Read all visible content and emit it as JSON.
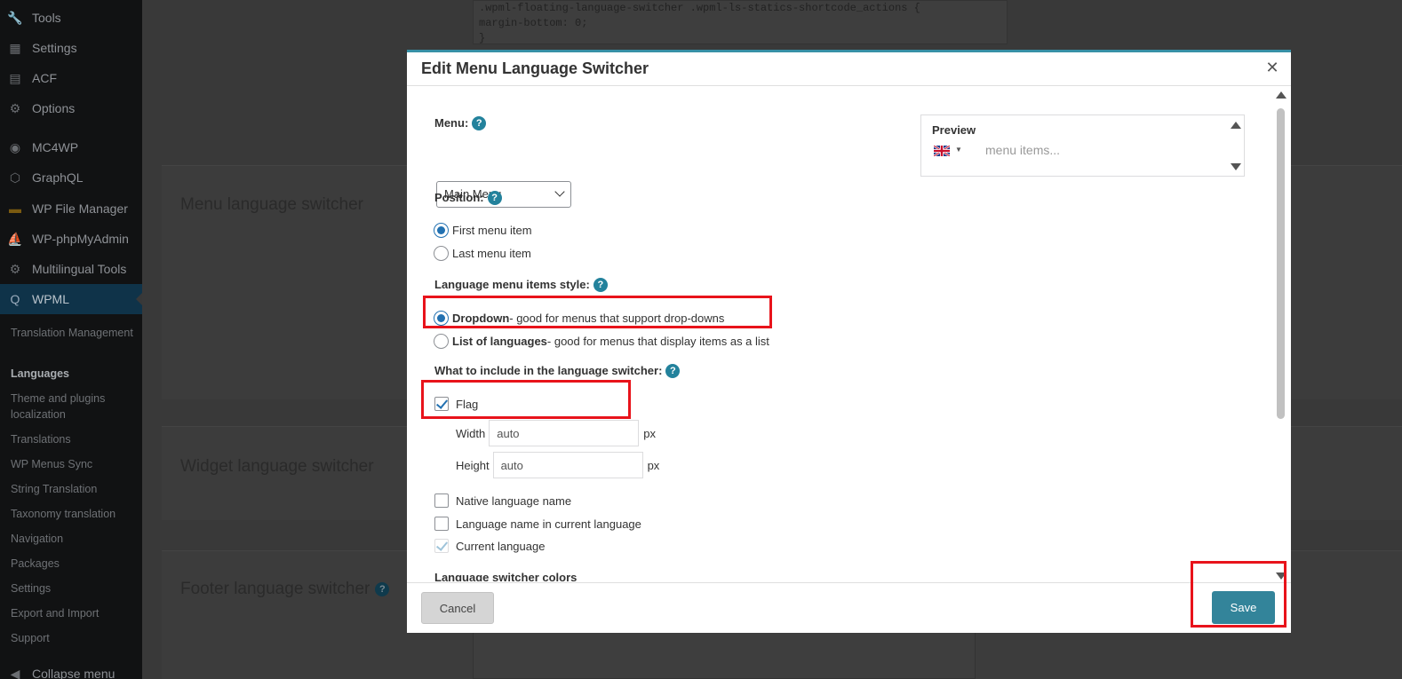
{
  "sidebar": {
    "items": [
      {
        "label": "Tools",
        "icon": "wrench-icon"
      },
      {
        "label": "Settings",
        "icon": "settings-sliders-icon"
      },
      {
        "label": "ACF",
        "icon": "grid-icon"
      },
      {
        "label": "Options",
        "icon": "gear-icon"
      },
      {
        "label": "MC4WP",
        "icon": "mc4wp-icon"
      },
      {
        "label": "GraphQL",
        "icon": "graphql-icon"
      },
      {
        "label": "WP File Manager",
        "icon": "folder-icon"
      },
      {
        "label": "WP-phpMyAdmin",
        "icon": "sail-icon"
      },
      {
        "label": "Multilingual Tools",
        "icon": "gear-icon"
      },
      {
        "label": "WPML",
        "icon": "wpml-icon"
      }
    ],
    "submenu": [
      "Translation Management",
      "Languages",
      "Theme and plugins localization",
      "Translations",
      "WP Menus Sync",
      "String Translation",
      "Taxonomy translation",
      "Navigation",
      "Packages",
      "Settings",
      "Export and Import",
      "Support"
    ],
    "collapse_label": "Collapse menu"
  },
  "background": {
    "code_lines": [
      ".wpml-floating-language-switcher .wpml-ls-statics-shortcode_actions {",
      "  margin-bottom: 0;",
      "}"
    ],
    "sections": [
      "Menu language switcher",
      "Widget language switcher",
      "Footer language switcher"
    ]
  },
  "modal": {
    "title": "Edit Menu Language Switcher",
    "menu_label": "Menu:",
    "menu_value": "Main Menu",
    "position_label": "Position:",
    "position_options": [
      "First menu item",
      "Last menu item"
    ],
    "style_label": "Language menu items style:",
    "style_options": [
      {
        "bold": "Dropdown",
        "rest": " - good for menus that support drop-downs"
      },
      {
        "bold": "List of languages",
        "rest": " - good for menus that display items as a list"
      }
    ],
    "include_label": "What to include in the language switcher:",
    "flag_label": "Flag",
    "width_label": "Width",
    "width_value": "auto",
    "height_label": "Height",
    "height_value": "auto",
    "unit": "px",
    "native_label": "Native language name",
    "current_lang_name_label": "Language name in current language",
    "current_language_label": "Current language",
    "colors_label": "Language switcher colors",
    "preview_title": "Preview",
    "preview_items": "menu items...",
    "cancel_label": "Cancel",
    "save_label": "Save"
  },
  "colors": {
    "accent": "#33849a",
    "help": "#23829c",
    "highlight": "#e8131b",
    "radio_checked": "#2271b1"
  }
}
